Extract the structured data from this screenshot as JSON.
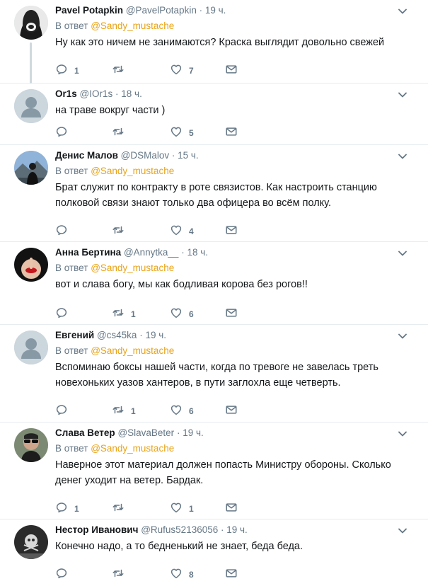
{
  "colors": {
    "mention": "#e8a317",
    "secondary": "#657786",
    "divider": "#e6ecf0"
  },
  "reply_prefix": "В ответ",
  "tweets": [
    {
      "name": "Pavel Potapkin",
      "handle": "@PavelPotapkin",
      "time": "19 ч.",
      "reply_to": "@Sandy_mustache",
      "text": "Ну как это ничем не занимаются? Краска выглядит довольно свежей",
      "replies": "1",
      "retweets": "",
      "likes": "7",
      "avatar": "hooded-figure-avatar"
    },
    {
      "name": "Or1s",
      "handle": "@IOr1s",
      "time": "18 ч.",
      "reply_to": "",
      "text": "на траве вокруг части )",
      "replies": "",
      "retweets": "",
      "likes": "5",
      "avatar": "default-avatar"
    },
    {
      "name": "Денис Малов",
      "handle": "@DSMalov",
      "time": "15 ч.",
      "reply_to": "@Sandy_mustache",
      "text": "Брат служит по контракту в роте связистов. Как настроить станцию полковой связи знают только два офицера во всём полку.",
      "replies": "",
      "retweets": "",
      "likes": "4",
      "avatar": "mountain-photo-avatar"
    },
    {
      "name": "Анна Бертина",
      "handle": "@Annytka__",
      "time": "18 ч.",
      "reply_to": "@Sandy_mustache",
      "text": "вот и слава богу, мы как бодливая корова без рогов!!",
      "replies": "",
      "retweets": "1",
      "likes": "6",
      "avatar": "lips-photo-avatar"
    },
    {
      "name": "Евгений",
      "handle": "@cs45ka",
      "time": "19 ч.",
      "reply_to": "@Sandy_mustache",
      "text": "Вспоминаю боксы нашей части, когда по тревоге не завелась треть новехоньких уазов хантеров, в пути заглохла еще четверть.",
      "replies": "",
      "retweets": "1",
      "likes": "6",
      "avatar": "default-avatar"
    },
    {
      "name": "Слава Ветер",
      "handle": "@SlavaBeter",
      "time": "19 ч.",
      "reply_to": "@Sandy_mustache",
      "text": "Наверное этот материал должен попасть Министру обороны. Сколько денег уходит на ветер. Бардак.",
      "replies": "1",
      "retweets": "",
      "likes": "1",
      "avatar": "sunglasses-photo-avatar"
    },
    {
      "name": "Нестор Иванович",
      "handle": "@Rufus52136056",
      "time": "19 ч.",
      "reply_to": "",
      "text": "Конечно надо, а то бедненький не знает, беда беда.",
      "replies": "",
      "retweets": "",
      "likes": "8",
      "avatar": "flag-photo-avatar"
    }
  ]
}
